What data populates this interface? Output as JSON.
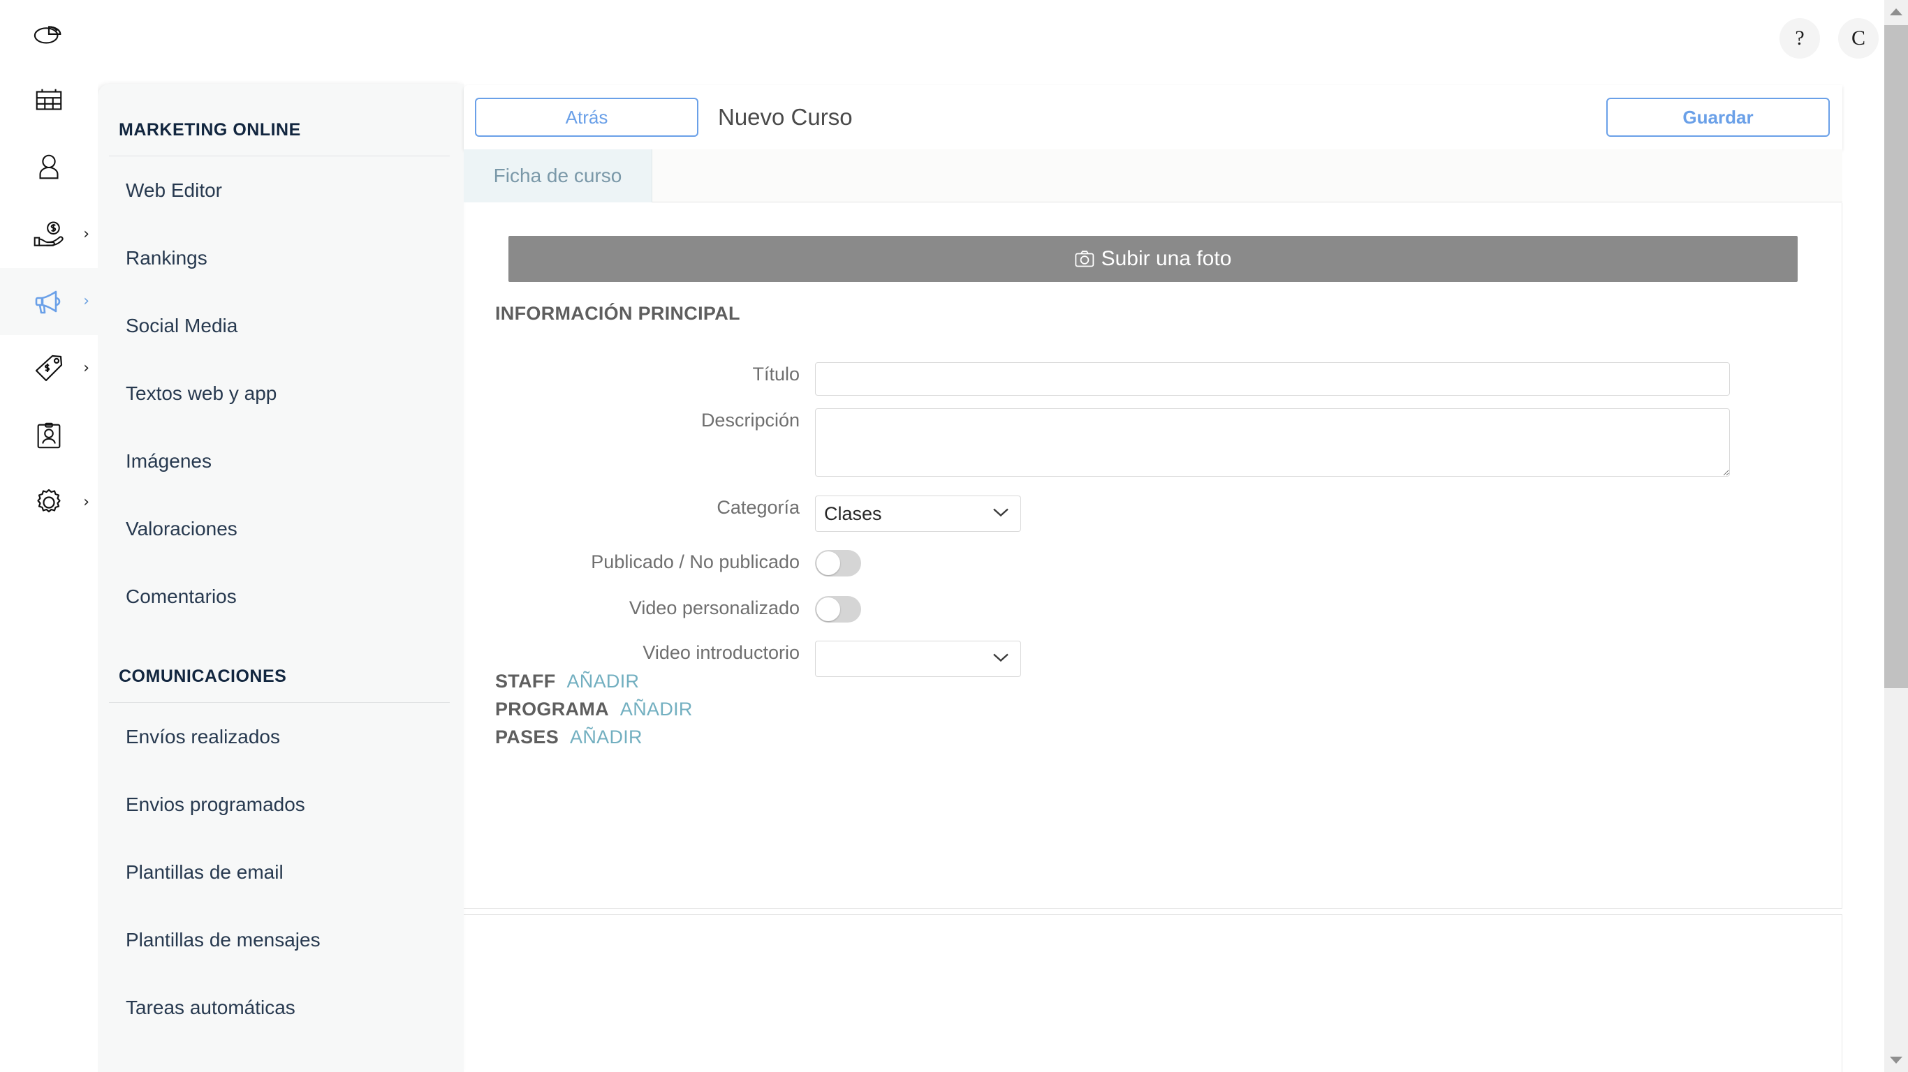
{
  "topbar": {
    "help_label": "?",
    "account_label": "C"
  },
  "rail": {
    "items": [
      {
        "name": "pie-chart-icon",
        "icon": "pie-chart",
        "has_chevron": false,
        "active": false
      },
      {
        "name": "calendar-icon",
        "icon": "calendar",
        "has_chevron": false,
        "active": false
      },
      {
        "name": "user-icon",
        "icon": "user",
        "has_chevron": false,
        "active": false
      },
      {
        "name": "money-hand-icon",
        "icon": "money-hand",
        "has_chevron": true,
        "active": false
      },
      {
        "name": "megaphone-icon",
        "icon": "megaphone",
        "has_chevron": true,
        "active": true
      },
      {
        "name": "price-tag-icon",
        "icon": "price-tag",
        "has_chevron": true,
        "active": false
      },
      {
        "name": "id-badge-icon",
        "icon": "id-badge",
        "has_chevron": false,
        "active": false
      },
      {
        "name": "gear-icon",
        "icon": "gear",
        "has_chevron": true,
        "active": false
      }
    ],
    "chevron_glyph": "›"
  },
  "sidebar": {
    "groups": [
      {
        "title": "MARKETING ONLINE",
        "items": [
          "Web Editor",
          "Rankings",
          "Social Media",
          "Textos web y app",
          "Imágenes",
          "Valoraciones",
          "Comentarios"
        ]
      },
      {
        "title": "COMUNICACIONES",
        "items": [
          "Envíos realizados",
          "Envios programados",
          "Plantillas de email",
          "Plantillas de mensajes",
          "Tareas automáticas"
        ]
      }
    ]
  },
  "header": {
    "back_label": "Atrás",
    "title": "Nuevo Curso",
    "save_label": "Guardar"
  },
  "tabs": [
    {
      "label": "Ficha de curso",
      "active": true
    }
  ],
  "main": {
    "upload_label": "Subir una foto",
    "upload_icon": "camera-icon",
    "section_info_title": "INFORMACIÓN PRINCIPAL",
    "fields": {
      "titulo": {
        "label": "Título",
        "value": "",
        "placeholder": ""
      },
      "descripcion": {
        "label": "Descripción",
        "value": "",
        "placeholder": ""
      },
      "categoria": {
        "label": "Categoría",
        "value": "Clases",
        "options": [
          "Clases"
        ]
      },
      "publicado": {
        "label": "Publicado / No publicado",
        "checked": false
      },
      "video_personalizado": {
        "label": "Video personalizado",
        "checked": false
      },
      "video_introductorio": {
        "label": "Video introductorio",
        "value": "",
        "options": [
          ""
        ]
      }
    },
    "subsections": [
      {
        "name": "STAFF",
        "add_label": "AÑADIR"
      },
      {
        "name": "PROGRAMA",
        "add_label": "AÑADIR"
      },
      {
        "name": "PASES",
        "add_label": "AÑADIR"
      }
    ]
  },
  "colors": {
    "accent_blue": "#6aa0e8",
    "tab_teal": "#72afc0",
    "upload_gray": "#8a8a8a",
    "sidebar_bg": "#f7f8f8",
    "heading_navy": "#12263f"
  }
}
